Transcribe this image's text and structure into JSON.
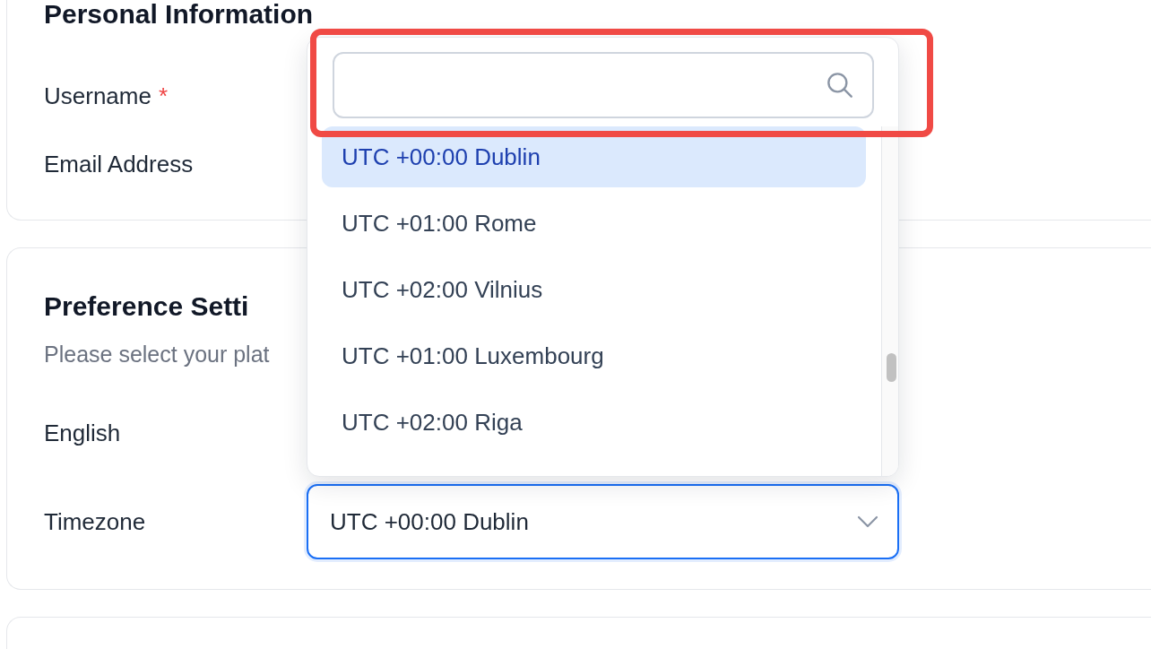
{
  "sections": [
    {
      "title": "Personal Information",
      "fields": [
        {
          "label": "Username",
          "required_mark": "*"
        },
        {
          "label": "Email Address"
        }
      ]
    },
    {
      "title": "Preference Setti",
      "subtitle": "Please select your plat",
      "fields": [
        {
          "label": "English"
        },
        {
          "label": "Timezone",
          "select": {
            "value": "UTC +00:00 Dublin",
            "focused": true,
            "open": true,
            "dropdown": {
              "search": {
                "highlighted": true
              },
              "options": [
                {
                  "label": "UTC +00:00 Dublin",
                  "selected": true
                },
                {
                  "label": "UTC +01:00 Rome",
                  "selected": false
                },
                {
                  "label": "UTC +02:00 Vilnius",
                  "selected": false
                },
                {
                  "label": "UTC +01:00 Luxembourg",
                  "selected": false
                },
                {
                  "label": "UTC +02:00 Riga",
                  "selected": false
                }
              ]
            }
          }
        }
      ]
    }
  ]
}
